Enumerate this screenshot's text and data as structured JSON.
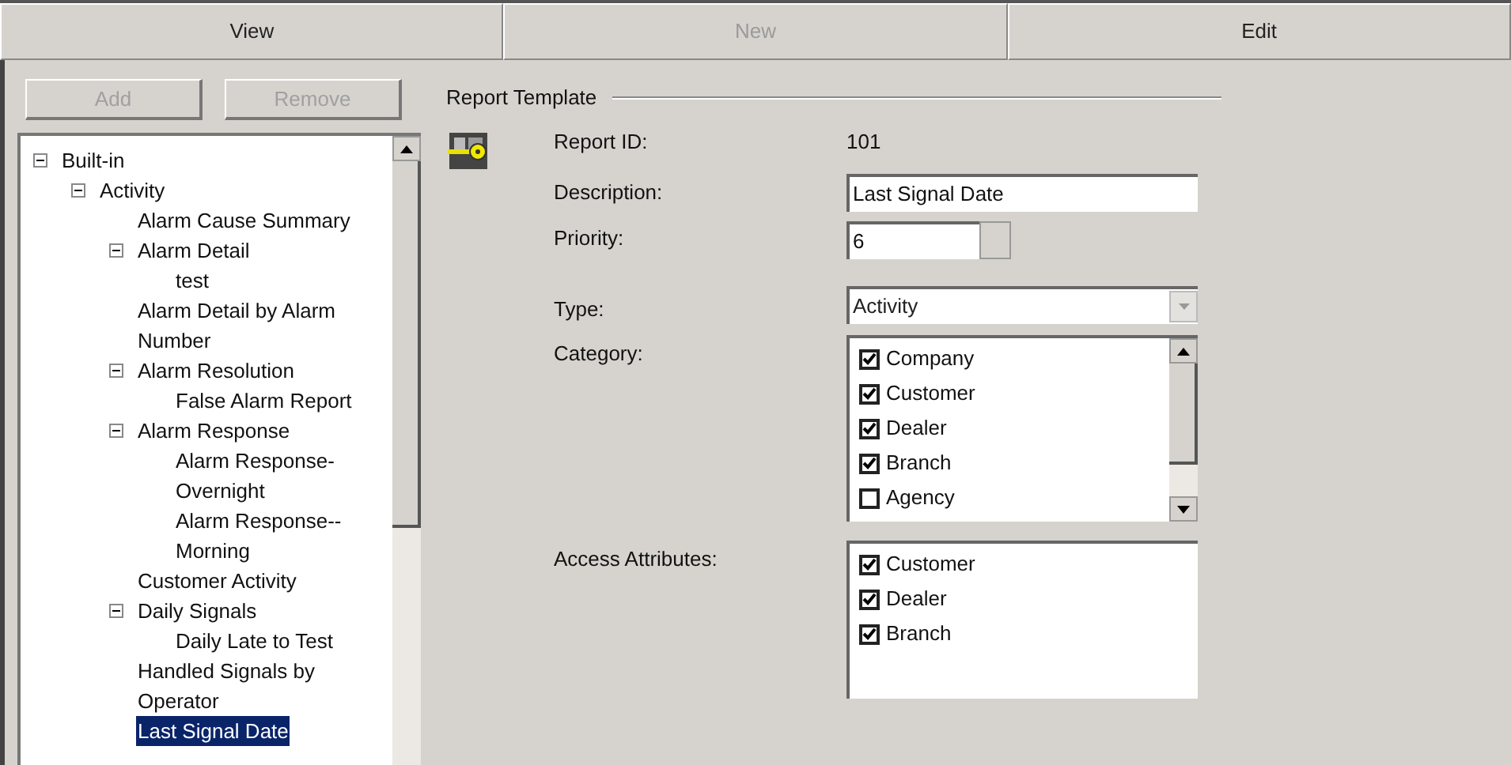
{
  "toolbar": [
    {
      "label": "View",
      "disabled": false
    },
    {
      "label": "New",
      "disabled": true
    },
    {
      "label": "Edit",
      "disabled": false
    }
  ],
  "tree_buttons": [
    {
      "label": "Add",
      "disabled": true
    },
    {
      "label": "Remove",
      "disabled": true
    }
  ],
  "tree": [
    {
      "label": "Built-in",
      "expanded": true,
      "selected": false,
      "children": [
        {
          "label": "Activity",
          "expanded": true,
          "selected": false,
          "children": [
            {
              "label": "Alarm Cause Summary",
              "selected": false
            },
            {
              "label": "Alarm Detail",
              "expanded": true,
              "selected": false,
              "children": [
                {
                  "label": "test",
                  "selected": false
                }
              ]
            },
            {
              "label": "Alarm Detail by Alarm Number",
              "selected": false
            },
            {
              "label": "Alarm Resolution",
              "expanded": true,
              "selected": false,
              "children": [
                {
                  "label": "False Alarm Report",
                  "selected": false
                }
              ]
            },
            {
              "label": "Alarm Response",
              "expanded": true,
              "selected": false,
              "children": [
                {
                  "label": "Alarm Response-Overnight",
                  "selected": false
                },
                {
                  "label": "Alarm Response--Morning",
                  "selected": false
                }
              ]
            },
            {
              "label": "Customer Activity",
              "selected": false
            },
            {
              "label": "Daily Signals",
              "expanded": true,
              "selected": false,
              "children": [
                {
                  "label": "Daily Late to Test",
                  "selected": false
                }
              ]
            },
            {
              "label": "Handled Signals by Operator",
              "selected": false
            },
            {
              "label": "Last Signal Date",
              "selected": true
            }
          ]
        }
      ]
    }
  ],
  "form": {
    "title": "Report Template",
    "report_id": {
      "label": "Report ID:",
      "value": "101"
    },
    "description": {
      "label": "Description:",
      "value": "Last Signal Date"
    },
    "priority": {
      "label": "Priority:",
      "value": "6"
    },
    "type": {
      "label": "Type:",
      "value": "Activity"
    },
    "category": {
      "label": "Category:",
      "items": [
        {
          "label": "Company",
          "checked": true
        },
        {
          "label": "Customer",
          "checked": true
        },
        {
          "label": "Dealer",
          "checked": true
        },
        {
          "label": "Branch",
          "checked": true
        },
        {
          "label": "Agency",
          "checked": false
        }
      ]
    },
    "access": {
      "label": "Access Attributes:",
      "items": [
        {
          "label": "Customer",
          "checked": true
        },
        {
          "label": "Dealer",
          "checked": true
        },
        {
          "label": "Branch",
          "checked": true
        }
      ]
    }
  }
}
